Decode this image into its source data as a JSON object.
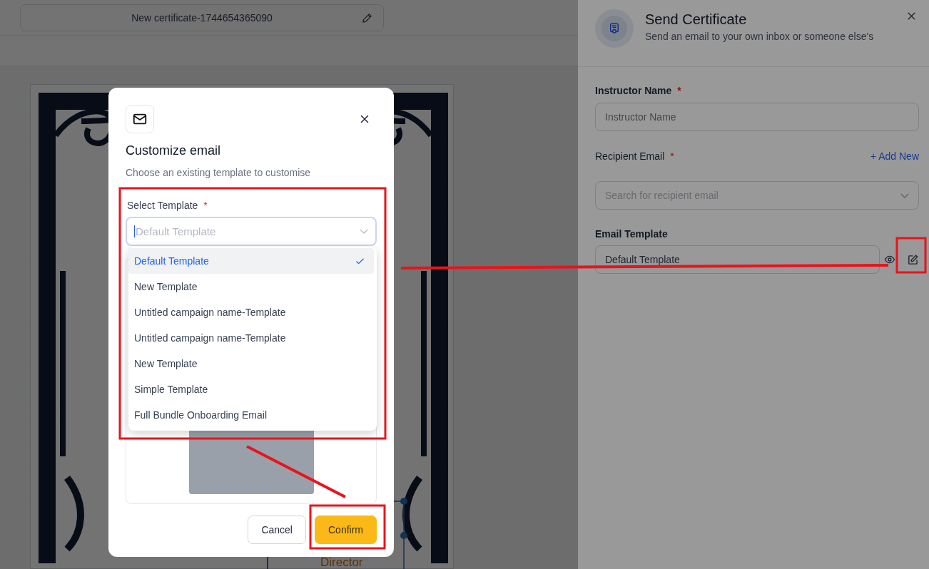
{
  "editor": {
    "certificate_name": "New certificate-1744654365090",
    "signature_title": "Director"
  },
  "send_panel": {
    "title": "Send Certificate",
    "subtitle": "Send an email to your own inbox or someone else's",
    "instructor": {
      "label": "Instructor Name",
      "required_mark": "*",
      "placeholder": "Instructor Name"
    },
    "recipient": {
      "label": "Recipient Email",
      "required_mark": "*",
      "add_link": "+ Add New",
      "placeholder": "Search for recipient email"
    },
    "email_template": {
      "label": "Email Template",
      "value": "Default Template"
    }
  },
  "modal": {
    "title": "Customize email",
    "subtitle": "Choose an existing template to customise",
    "select": {
      "label": "Select Template",
      "required_mark": "*",
      "placeholder": "Default Template",
      "expanded": true
    },
    "options": [
      {
        "label": "Default Template",
        "selected": true
      },
      {
        "label": "New Template",
        "selected": false
      },
      {
        "label": "Untitled campaign name-Template",
        "selected": false
      },
      {
        "label": "Untitled campaign name-Template",
        "selected": false
      },
      {
        "label": "New Template",
        "selected": false
      },
      {
        "label": "Simple Template",
        "selected": false
      },
      {
        "label": "Full Bundle Onboarding Email",
        "selected": false
      }
    ],
    "buttons": [
      {
        "label": "Cancel",
        "kind": "secondary"
      },
      {
        "label": "Confirm",
        "kind": "primary"
      }
    ]
  }
}
